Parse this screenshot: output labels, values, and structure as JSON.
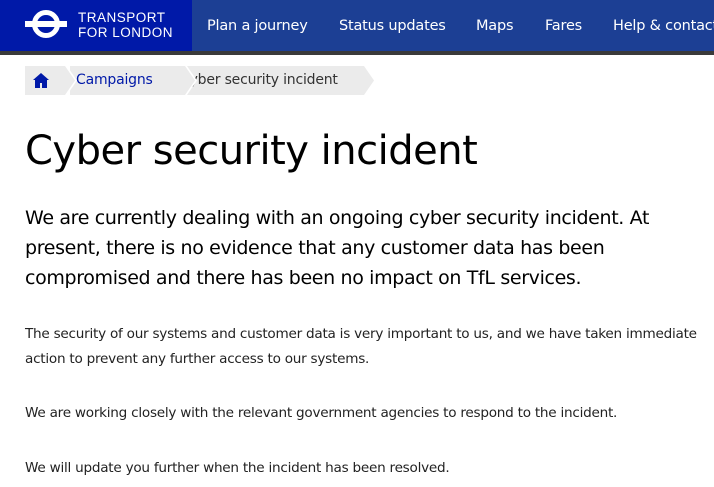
{
  "header": {
    "brand_line1": "TRANSPORT",
    "brand_line2": "FOR LONDON",
    "brand_logo": "tfl-roundel-icon",
    "colors": {
      "bar": "#1c3f94",
      "brand_block": "#0019a8"
    },
    "nav": [
      {
        "label": "Plan a journey"
      },
      {
        "label": "Status updates"
      },
      {
        "label": "Maps"
      },
      {
        "label": "Fares"
      },
      {
        "label": "Help & contacts"
      }
    ]
  },
  "breadcrumb": {
    "home_icon": "home-icon",
    "items": [
      {
        "label": "Campaigns"
      },
      {
        "label": "Cyber security incident"
      }
    ]
  },
  "page": {
    "title": "Cyber security incident",
    "lead": "We are currently dealing with an ongoing cyber security incident. At present, there is no evidence that any customer data has been compromised and there has been no impact on TfL services.",
    "paragraphs": [
      "The security of our systems and customer data is very important to us, and we have taken immediate action to prevent any further access to our systems.",
      "We are working closely with the relevant government agencies to respond to the incident.",
      "We will update you further when the incident has been resolved."
    ]
  }
}
